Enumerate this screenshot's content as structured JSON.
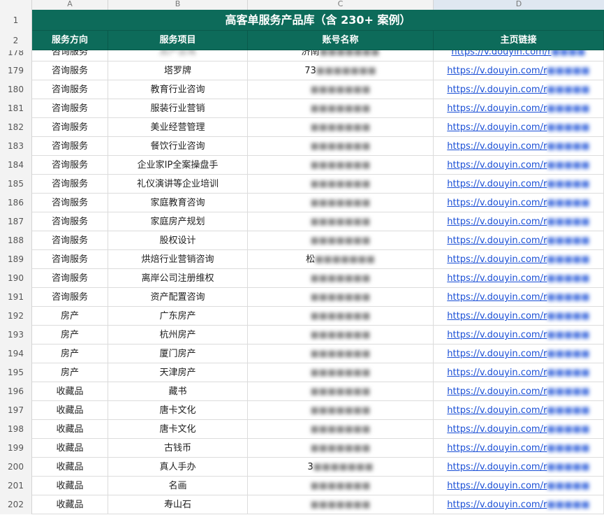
{
  "columns": [
    "A",
    "B",
    "C",
    "D"
  ],
  "selected_column": "D",
  "title": "高客单服务产品库（含 230+ 案例）",
  "headers": [
    "服务方向",
    "服务项目",
    "账号名称",
    "主页链接"
  ],
  "partial_row": {
    "num": "178",
    "dir": "咨询服务",
    "item": "房产咨询",
    "acct": "济南",
    "link": "https://v.douyin.com/r"
  },
  "link_prefix": "https://v.douyin.com/r",
  "rows": [
    {
      "num": "179",
      "dir": "咨询服务",
      "item": "塔罗牌",
      "acct": "73"
    },
    {
      "num": "180",
      "dir": "咨询服务",
      "item": "教育行业咨询",
      "acct": ""
    },
    {
      "num": "181",
      "dir": "咨询服务",
      "item": "服装行业营销",
      "acct": ""
    },
    {
      "num": "182",
      "dir": "咨询服务",
      "item": "美业经营管理",
      "acct": ""
    },
    {
      "num": "183",
      "dir": "咨询服务",
      "item": "餐饮行业咨询",
      "acct": ""
    },
    {
      "num": "184",
      "dir": "咨询服务",
      "item": "企业家IP全案操盘手",
      "acct": ""
    },
    {
      "num": "185",
      "dir": "咨询服务",
      "item": "礼仪演讲等企业培训",
      "acct": ""
    },
    {
      "num": "186",
      "dir": "咨询服务",
      "item": "家庭教育咨询",
      "acct": ""
    },
    {
      "num": "187",
      "dir": "咨询服务",
      "item": "家庭房产规划",
      "acct": ""
    },
    {
      "num": "188",
      "dir": "咨询服务",
      "item": "股权设计",
      "acct": ""
    },
    {
      "num": "189",
      "dir": "咨询服务",
      "item": "烘焙行业营销咨询",
      "acct": "松"
    },
    {
      "num": "190",
      "dir": "咨询服务",
      "item": "离岸公司注册维权",
      "acct": ""
    },
    {
      "num": "191",
      "dir": "咨询服务",
      "item": "资产配置咨询",
      "acct": ""
    },
    {
      "num": "192",
      "dir": "房产",
      "item": "广东房产",
      "acct": ""
    },
    {
      "num": "193",
      "dir": "房产",
      "item": "杭州房产",
      "acct": ""
    },
    {
      "num": "194",
      "dir": "房产",
      "item": "厦门房产",
      "acct": ""
    },
    {
      "num": "195",
      "dir": "房产",
      "item": "天津房产",
      "acct": ""
    },
    {
      "num": "196",
      "dir": "收藏品",
      "item": "藏书",
      "acct": ""
    },
    {
      "num": "197",
      "dir": "收藏品",
      "item": "唐卡文化",
      "acct": ""
    },
    {
      "num": "198",
      "dir": "收藏品",
      "item": "唐卡文化",
      "acct": ""
    },
    {
      "num": "199",
      "dir": "收藏品",
      "item": "古钱币",
      "acct": ""
    },
    {
      "num": "200",
      "dir": "收藏品",
      "item": "真人手办",
      "acct": "3"
    },
    {
      "num": "201",
      "dir": "收藏品",
      "item": "名画",
      "acct": ""
    },
    {
      "num": "202",
      "dir": "收藏品",
      "item": "寿山石",
      "acct": ""
    }
  ],
  "colors": {
    "header_bg": "#0d6b5a",
    "link": "#1a4fd6",
    "grid": "#dcdcdc"
  }
}
